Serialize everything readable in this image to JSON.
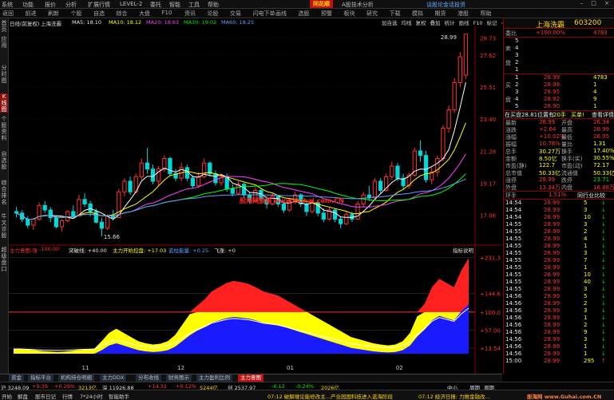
{
  "menu": {
    "items": [
      "系统",
      "功能",
      "报价",
      "分析",
      "扩展行情",
      "LEVEL-2",
      "委托",
      "智能",
      "工具",
      "帮助"
    ],
    "logo": "同花顺",
    "tab_title": "A股技术分析",
    "notice": "谈股论金话投资",
    "window_controls": "– □ ×"
  },
  "toolbar": {
    "items": [
      "返回",
      "前进",
      "刷新",
      "个股",
      "自选",
      "综合",
      "大盘",
      "F10",
      "资讯",
      "论股",
      "交易",
      "闪电下单",
      "画线",
      "选股",
      "预警",
      "板块",
      "研究",
      "下载",
      "模拟",
      "期货",
      "港股",
      "帮助"
    ]
  },
  "leftnav": {
    "items": [
      "首页",
      "应用",
      "分时图",
      "K线图",
      "个股资料",
      "自选股",
      "综合排名",
      "牛叉诊股",
      "超级盘口"
    ],
    "active_index": 3
  },
  "chart_header": {
    "period": "日线(前复权)",
    "stock": "上海洗霸",
    "ma5": "MA5: 18.10",
    "ma10": "MA10: 18.12",
    "ma20": "MA20: 18.63",
    "ma30": "MA30: 19.02",
    "ma60": "MA60: 18.25",
    "tools": [
      "加自选",
      "均线",
      "复权",
      "叠加",
      "统计",
      "画线",
      "F10",
      "标记",
      "−",
      "+",
      "▸"
    ],
    "watermark": "股海网股票 www.Guhai.com.CN"
  },
  "indicator_header": {
    "name": "主力意图:强",
    "v1": "-100.00",
    "v2": "突破线: +40.00",
    "v3": "主力开始控盘: +17.03",
    "v4": "蓝柱能量: +0.25",
    "v5": "飞涨: +0",
    "help": "指标说明"
  },
  "bottom_tabs": {
    "items": [
      "资金",
      "指标平台",
      "机构持仓明细",
      "主力DDX",
      "分布收线",
      "财务图示",
      "主力盈利比例",
      "主力意图"
    ],
    "active_index": 7
  },
  "ticker": {
    "items": [
      "沪 3248.09",
      "+9.39",
      "+0.29%",
      "3213亿",
      "深 11926.88",
      "+14.32",
      "+0.12%",
      "5244亿",
      "创 2537.97",
      "-6.12",
      "-0.24%",
      "2026亿",
      "中小",
      "周期",
      "周期"
    ]
  },
  "statusbar": {
    "items": [
      "开始",
      "解盘",
      "股市日记",
      "行情",
      "7*24小时",
      "智能助手"
    ],
    "msg1": "07:12 破解缠论能修改主...产业园国科技进入蓝海阶段",
    "msg2": "07:12 经济日报: 力推金融改...",
    "watermark": "股海网 www.Guhai.com.CN"
  },
  "quote": {
    "name": "上海洗霸",
    "code": "603200",
    "weibi_label": "委比",
    "weibi": "+100.00%",
    "weicha": "4783",
    "sell_labels": [
      "5",
      "4",
      "3",
      "2",
      "1"
    ],
    "sell_prices": [
      "",
      "",
      "",
      "",
      ""
    ],
    "sell_vols": [
      "",
      "",
      "",
      "",
      ""
    ],
    "buy_labels": [
      "1",
      "2",
      "3",
      "4",
      "5"
    ],
    "buy_prices": [
      "28.99",
      "28.98",
      "28.95",
      "28.92",
      "28.90"
    ],
    "buy_vols": [
      "4783",
      "1",
      "4",
      "9",
      "1"
    ],
    "mai_label": "卖",
    "pan_label": "盘",
    "mai2_label": "买",
    "pan2_label": "盘",
    "summary_row": [
      "在买盘28.81位置有",
      "20手",
      "买单!",
      "查看详情"
    ],
    "stats": [
      {
        "l1": "最新",
        "v1": "28.99",
        "l2": "开盘",
        "v2": "26.34"
      },
      {
        "l1": "涨跌",
        "v1": "+2.64",
        "l2": "最高",
        "v2": "28.99"
      },
      {
        "l1": "涨幅",
        "v1": "+10.02%",
        "l2": "最低",
        "v2": "26.05"
      },
      {
        "l1": "振幅",
        "v1": "10.78%",
        "l2": "量比",
        "v2": "1.31"
      },
      {
        "l1": "总手",
        "v1": "30.27万",
        "l2": "换手",
        "v2": "17.40%"
      },
      {
        "l1": "金额",
        "v1": "8.50亿",
        "l2": "换手(实)",
        "v2": "30.55%"
      },
      {
        "l1": "市盈(静)",
        "v1": "122.7",
        "l2": "市盈(动)",
        "v2": "72.17"
      },
      {
        "l1": "总市值",
        "v1": "50.33亿",
        "l2": "流通值",
        "v2": "50.33亿"
      },
      {
        "l1": "涨停",
        "v1": "28.99",
        "l2": "跌停",
        "v2": "23.71"
      },
      {
        "l1": "外盘",
        "v1": "13.34万",
        "l2": "内盘",
        "v2": "16.88万"
      }
    ],
    "turnover_label": "环手",
    "turnover_val": "1.51%",
    "turnover_tail": "同行业比较",
    "ticks": [
      {
        "t": "14:54",
        "p": "28.99",
        "v": "5",
        "d": "down"
      },
      {
        "t": "14:54",
        "p": "28.99",
        "v": "3",
        "d": "down"
      },
      {
        "t": "14:54",
        "p": "28.99",
        "v": "10",
        "d": "down"
      },
      {
        "t": "14:55",
        "p": "28.99",
        "v": "3",
        "d": "down"
      },
      {
        "t": "14:55",
        "p": "28.99",
        "v": "2",
        "d": "down"
      },
      {
        "t": "14:55",
        "p": "28.99",
        "v": "4",
        "d": "down"
      },
      {
        "t": "14:55",
        "p": "28.99",
        "v": "1",
        "d": "down"
      },
      {
        "t": "14:55",
        "p": "28.99",
        "v": "3",
        "d": "down"
      },
      {
        "t": "14:55",
        "p": "28.99",
        "v": "7",
        "d": "down"
      },
      {
        "t": "14:55",
        "p": "28.99",
        "v": "1",
        "d": "down"
      },
      {
        "t": "14:55",
        "p": "28.99",
        "v": "10",
        "d": "down"
      },
      {
        "t": "14:55",
        "p": "28.99",
        "v": "40",
        "d": "down"
      },
      {
        "t": "14:55",
        "p": "28.99",
        "v": "3",
        "d": "down"
      },
      {
        "t": "14:56",
        "p": "28.99",
        "v": "5",
        "d": "down"
      },
      {
        "t": "14:56",
        "p": "28.99",
        "v": "2",
        "d": "down"
      },
      {
        "t": "14:56",
        "p": "28.99",
        "v": "3",
        "d": "down"
      },
      {
        "t": "14:56",
        "p": "28.99",
        "v": "1",
        "d": "down"
      },
      {
        "t": "14:56",
        "p": "28.99",
        "v": "2",
        "d": "down"
      },
      {
        "t": "14:56",
        "p": "28.99",
        "v": "9",
        "d": "down"
      },
      {
        "t": "14:56",
        "p": "28.99",
        "v": "3",
        "d": "down"
      },
      {
        "t": "14:56",
        "p": "28.99",
        "v": "1",
        "d": "down"
      },
      {
        "t": "14:56",
        "p": "28.99",
        "v": "1",
        "d": "down"
      },
      {
        "t": "15:00",
        "p": "28.99",
        "v": "295",
        "d": "up"
      }
    ]
  },
  "chart_data": [
    {
      "type": "candlestick",
      "title": "上海洗霸 日线",
      "yticks": [
        "28.73",
        "27.62",
        "25.51",
        "23.40",
        "21.28",
        "19.17",
        "17.06"
      ],
      "labels": {
        "high": "28.99",
        "low": "15.66"
      },
      "xticks": [
        "11",
        "12",
        "01",
        "02"
      ],
      "ohlc": [
        [
          17.3,
          17.6,
          16.9,
          17.2
        ],
        [
          17.2,
          17.4,
          16.6,
          16.8
        ],
        [
          16.8,
          17.0,
          16.2,
          16.4
        ],
        [
          16.4,
          16.9,
          16.1,
          16.8
        ],
        [
          16.8,
          17.9,
          16.7,
          17.7
        ],
        [
          17.7,
          18.0,
          17.2,
          17.4
        ],
        [
          17.4,
          17.6,
          16.6,
          16.9
        ],
        [
          16.9,
          17.0,
          16.2,
          16.3
        ],
        [
          16.3,
          16.8,
          16.0,
          16.7
        ],
        [
          16.7,
          17.4,
          16.6,
          17.3
        ],
        [
          17.3,
          17.7,
          16.9,
          17.0
        ],
        [
          17.0,
          18.4,
          17.0,
          18.1
        ],
        [
          18.1,
          18.5,
          17.6,
          17.8
        ],
        [
          17.8,
          18.0,
          17.0,
          17.3
        ],
        [
          17.3,
          17.5,
          16.5,
          16.6
        ],
        [
          16.6,
          16.9,
          15.66,
          16.2
        ],
        [
          16.2,
          17.1,
          16.1,
          17.0
        ],
        [
          17.0,
          17.4,
          16.7,
          16.9
        ],
        [
          16.9,
          18.8,
          16.9,
          18.6
        ],
        [
          18.6,
          19.5,
          18.3,
          19.3
        ],
        [
          19.3,
          19.6,
          18.4,
          18.6
        ],
        [
          18.6,
          19.8,
          18.5,
          19.6
        ],
        [
          19.6,
          20.8,
          19.4,
          20.5
        ],
        [
          20.5,
          21.5,
          19.8,
          20.1
        ],
        [
          20.1,
          20.4,
          19.1,
          19.3
        ],
        [
          19.3,
          20.3,
          19.0,
          20.1
        ],
        [
          20.1,
          21.0,
          19.9,
          20.8
        ],
        [
          20.8,
          20.9,
          19.6,
          19.8
        ],
        [
          19.8,
          20.1,
          19.3,
          19.5
        ],
        [
          19.5,
          20.5,
          19.3,
          20.2
        ],
        [
          20.2,
          20.4,
          19.3,
          19.5
        ],
        [
          19.5,
          19.7,
          18.8,
          19.0
        ],
        [
          19.0,
          19.9,
          18.9,
          19.6
        ],
        [
          19.6,
          20.8,
          19.5,
          20.5
        ],
        [
          20.5,
          20.6,
          19.6,
          19.8
        ],
        [
          19.8,
          20.0,
          19.0,
          19.2
        ],
        [
          19.2,
          19.8,
          19.0,
          19.6
        ],
        [
          19.6,
          19.8,
          18.6,
          18.8
        ],
        [
          18.8,
          19.1,
          18.3,
          18.5
        ],
        [
          18.5,
          19.3,
          18.4,
          19.1
        ],
        [
          19.1,
          19.2,
          18.2,
          18.4
        ],
        [
          18.4,
          18.6,
          17.8,
          18.0
        ],
        [
          18.0,
          18.9,
          17.9,
          18.7
        ],
        [
          18.7,
          18.8,
          17.9,
          18.1
        ],
        [
          18.1,
          18.3,
          17.5,
          17.8
        ],
        [
          17.8,
          18.5,
          17.7,
          18.3
        ],
        [
          18.3,
          18.4,
          17.6,
          17.8
        ],
        [
          17.8,
          18.0,
          17.2,
          17.4
        ],
        [
          17.4,
          18.2,
          17.3,
          18.0
        ],
        [
          18.0,
          18.6,
          17.8,
          18.4
        ],
        [
          18.4,
          18.5,
          17.6,
          17.8
        ],
        [
          17.8,
          18.0,
          17.0,
          17.3
        ],
        [
          17.3,
          18.1,
          17.2,
          17.9
        ],
        [
          17.9,
          18.0,
          17.0,
          17.2
        ],
        [
          17.2,
          17.5,
          16.6,
          16.8
        ],
        [
          16.8,
          17.6,
          16.7,
          17.4
        ],
        [
          17.4,
          17.5,
          16.6,
          16.8
        ],
        [
          16.8,
          17.0,
          16.2,
          16.5
        ],
        [
          16.5,
          17.3,
          16.4,
          17.1
        ],
        [
          17.1,
          17.3,
          16.6,
          16.8
        ],
        [
          16.8,
          18.0,
          16.8,
          17.8
        ],
        [
          17.8,
          18.6,
          17.6,
          18.4
        ],
        [
          18.4,
          19.0,
          18.0,
          18.2
        ],
        [
          18.2,
          19.5,
          18.1,
          19.3
        ],
        [
          19.3,
          19.5,
          18.5,
          18.7
        ],
        [
          18.7,
          19.8,
          18.6,
          19.6
        ],
        [
          19.6,
          20.6,
          19.4,
          20.3
        ],
        [
          20.3,
          20.5,
          19.3,
          19.5
        ],
        [
          19.5,
          19.8,
          18.8,
          19.0
        ],
        [
          19.0,
          19.9,
          18.8,
          19.7
        ],
        [
          19.7,
          21.5,
          19.6,
          21.3
        ],
        [
          21.3,
          22.0,
          20.6,
          21.0
        ],
        [
          21.0,
          21.3,
          19.2,
          19.4
        ],
        [
          19.4,
          20.2,
          19.1,
          19.9
        ],
        [
          19.9,
          21.0,
          19.6,
          20.8
        ],
        [
          20.8,
          23.0,
          20.6,
          22.8
        ],
        [
          22.8,
          24.3,
          22.5,
          24.0
        ],
        [
          24.0,
          26.1,
          23.8,
          25.8
        ],
        [
          25.8,
          27.8,
          25.5,
          27.5
        ],
        [
          26.3,
          28.99,
          26.05,
          28.99
        ]
      ],
      "ma_lines": [
        {
          "name": "MA5",
          "color": "#ffffff"
        },
        {
          "name": "MA10",
          "color": "#ffff00"
        },
        {
          "name": "MA20",
          "color": "#ff40ff"
        },
        {
          "name": "MA30",
          "color": "#00ff00"
        },
        {
          "name": "MA60",
          "color": "#5aa0ff"
        }
      ]
    },
    {
      "type": "area",
      "title": "主力意图",
      "yticks": [
        "+231.3",
        "+144.6",
        "+100.0",
        "+57.00",
        "+13.54"
      ],
      "values": [
        12,
        12,
        10,
        8,
        6,
        5,
        4,
        5,
        7,
        9,
        10,
        12,
        30,
        50,
        60,
        50,
        40,
        30,
        25,
        22,
        24,
        30,
        45,
        70,
        95,
        115,
        130,
        150,
        160,
        170,
        175,
        172,
        168,
        160,
        150,
        145,
        140,
        130,
        120,
        110,
        100,
        90,
        80,
        70,
        60,
        50,
        40,
        35,
        30,
        25,
        22,
        20,
        22,
        30,
        50,
        90,
        120,
        160,
        180,
        170,
        160,
        200,
        230
      ]
    }
  ]
}
